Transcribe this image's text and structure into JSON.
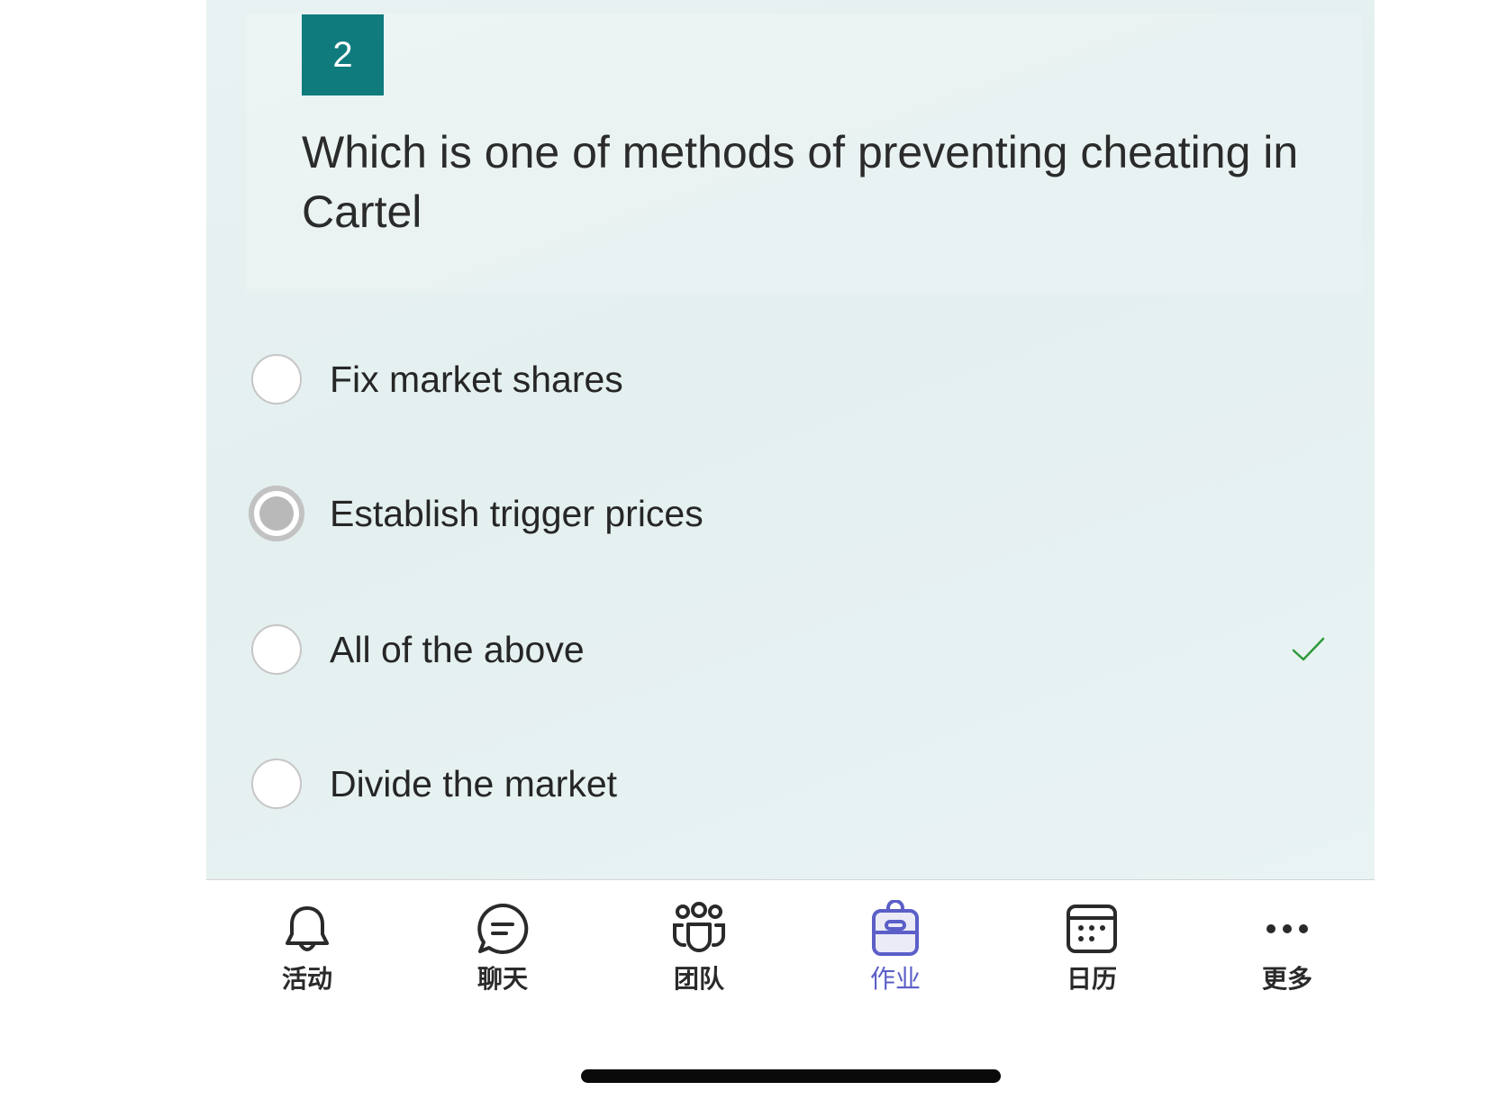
{
  "question": {
    "number": "2",
    "text": "Which is one of methods of preventing cheating in Cartel"
  },
  "options": [
    {
      "label": "Fix market shares",
      "selected": false,
      "correct": false
    },
    {
      "label": "Establish trigger prices",
      "selected": true,
      "correct": false
    },
    {
      "label": "All of the above",
      "selected": false,
      "correct": true
    },
    {
      "label": "Divide the market",
      "selected": false,
      "correct": false
    }
  ],
  "tabbar": {
    "items": [
      {
        "label": "活动",
        "icon": "bell-icon",
        "active": false
      },
      {
        "label": "聊天",
        "icon": "chat-icon",
        "active": false
      },
      {
        "label": "团队",
        "icon": "teams-icon",
        "active": false
      },
      {
        "label": "作业",
        "icon": "backpack-icon",
        "active": true
      },
      {
        "label": "日历",
        "icon": "calendar-icon",
        "active": false
      },
      {
        "label": "更多",
        "icon": "more-icon",
        "active": false
      }
    ]
  },
  "colors": {
    "accent": "#0f7b7d",
    "active_tab": "#5b5fc7",
    "correct_check": "#2e9a3a"
  }
}
